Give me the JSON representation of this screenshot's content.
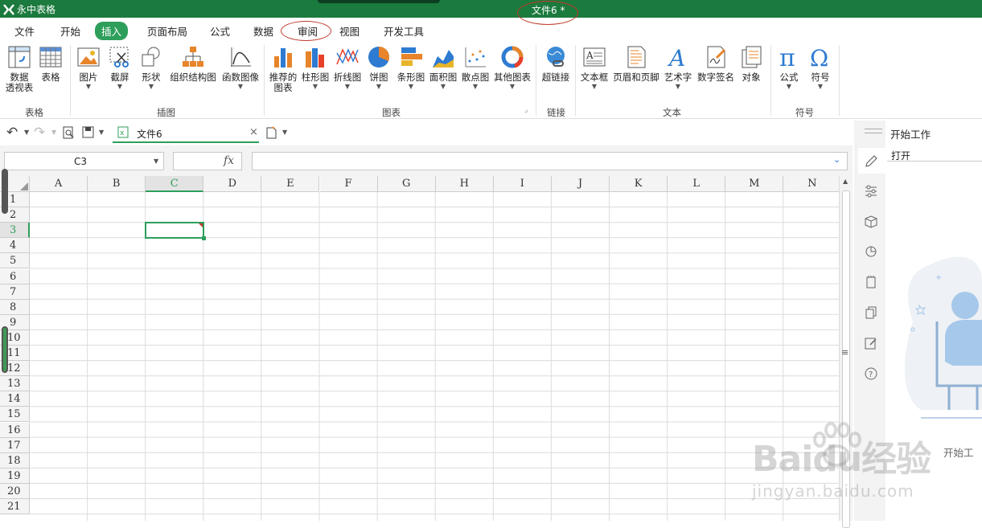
{
  "titlebar": {
    "app_name": "永中表格",
    "doc_title": "文件6 *"
  },
  "menu": {
    "items": [
      "文件",
      "开始",
      "插入",
      "页面布局",
      "公式",
      "数据",
      "审阅",
      "视图",
      "开发工具"
    ],
    "active": "插入",
    "highlighted": "审阅"
  },
  "ribbon": {
    "buttons": [
      "数据\n透视表",
      "表格",
      "图片",
      "截屏",
      "形状",
      "组织结构图",
      "函数图像",
      "推荐的\n图表",
      "柱形图",
      "折线图",
      "饼图",
      "条形图",
      "面积图",
      "散点图",
      "其他图表",
      "超链接",
      "文本框",
      "页眉和页脚",
      "艺术字",
      "数字签名",
      "对象",
      "公式",
      "符号"
    ],
    "groups": [
      "表格",
      "插图",
      "图表",
      "链接",
      "文本",
      "符号"
    ]
  },
  "quick_access": {
    "tab_label": "文件6"
  },
  "formula_bar": {
    "cell_ref": "C3",
    "fx": "fx",
    "value": ""
  },
  "sheet": {
    "columns": [
      "A",
      "B",
      "C",
      "D",
      "E",
      "F",
      "G",
      "H",
      "I",
      "J",
      "K",
      "L",
      "M",
      "N"
    ],
    "rows": [
      "1",
      "2",
      "3",
      "4",
      "5",
      "6",
      "7",
      "8",
      "9",
      "10",
      "11",
      "12",
      "13",
      "14",
      "15",
      "16",
      "17",
      "18",
      "19",
      "20",
      "21"
    ],
    "selected_cell": "C3"
  },
  "right_panel": {
    "title": "开始工作",
    "item": "打开",
    "illustration_caption": "开始工"
  },
  "watermark": {
    "brand": "Baidu经验",
    "url": "jingyan.baidu.com"
  },
  "colors": {
    "title_green": "#1b7a3d",
    "accent": "#2e9e5b",
    "ellipse": "#c0392b"
  }
}
